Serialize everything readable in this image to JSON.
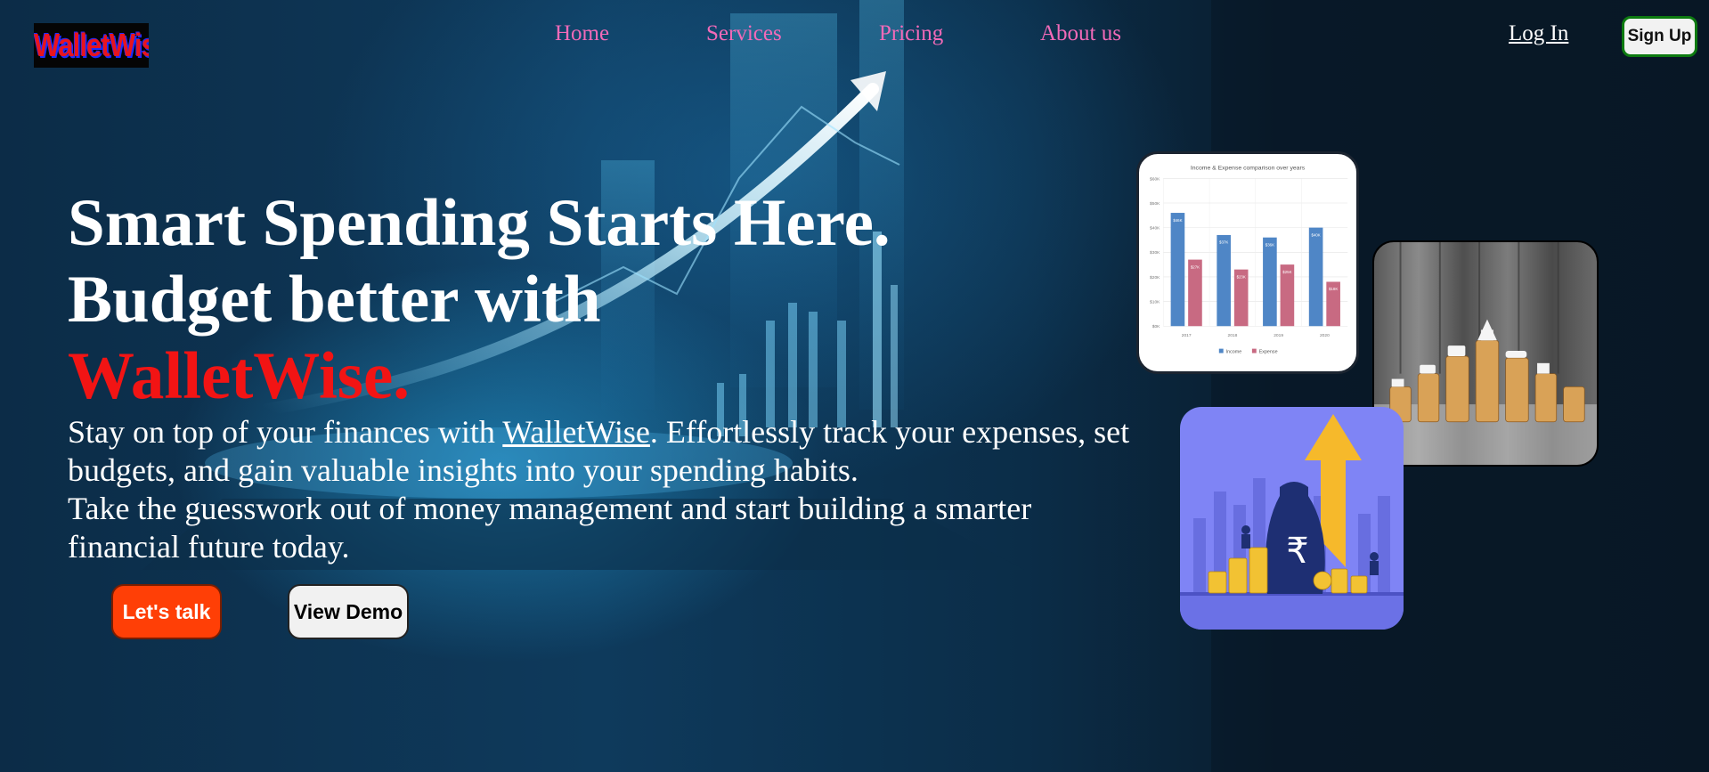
{
  "brand": {
    "logo_text": "WalletWise"
  },
  "nav": {
    "links": [
      "Home",
      "Services",
      "Pricing",
      "About us"
    ],
    "login_label": "Log In",
    "signup_label": "Sign Up"
  },
  "hero": {
    "headline_line1": "Smart Spending Starts Here.",
    "headline_line2": "Budget better with",
    "headline_brand": "WalletWise.",
    "lead_before": "Stay on top of your finances with ",
    "lead_link": "WalletWise",
    "lead_after": ". Effortlessly track your expenses, set budgets, and gain valuable insights into your spending habits.",
    "lead_line2": "Take the guesswork out of money management and start building a smarter financial future today.",
    "primary_button": "Let's talk",
    "secondary_button": "View Demo"
  },
  "preview_chart": {
    "title": "Income & Expense comparison over years",
    "chart_data": {
      "type": "bar",
      "categories": [
        "2017",
        "2018",
        "2019",
        "2020"
      ],
      "series": [
        {
          "name": "Income",
          "values": [
            46,
            37,
            36,
            40
          ],
          "labels": [
            "$46K",
            "$37K",
            "$36K",
            "$40K"
          ]
        },
        {
          "name": "Expense",
          "values": [
            27,
            23,
            25,
            18
          ],
          "labels": [
            "$27K",
            "$23K",
            "$25K",
            "$18K"
          ]
        }
      ],
      "y_ticks": [
        "$0K",
        "$10K",
        "$20K",
        "$30K",
        "$40K",
        "$50K",
        "$60K"
      ],
      "ylim": [
        0,
        60
      ],
      "legend": "bottom"
    }
  },
  "colors": {
    "nav_link": "#f26ab8",
    "brand_red": "#f21414",
    "talk_button": "#ff3f06",
    "signup_border": "#0d7a10",
    "income_bar": "#4f86c6",
    "expense_bar": "#c86a82",
    "rupee_card": "#7f84f5"
  },
  "icons": {
    "rupee": "rupee-icon",
    "growth_arrow": "arrow-up-icon",
    "house": "house-icon",
    "car": "car-icon"
  }
}
